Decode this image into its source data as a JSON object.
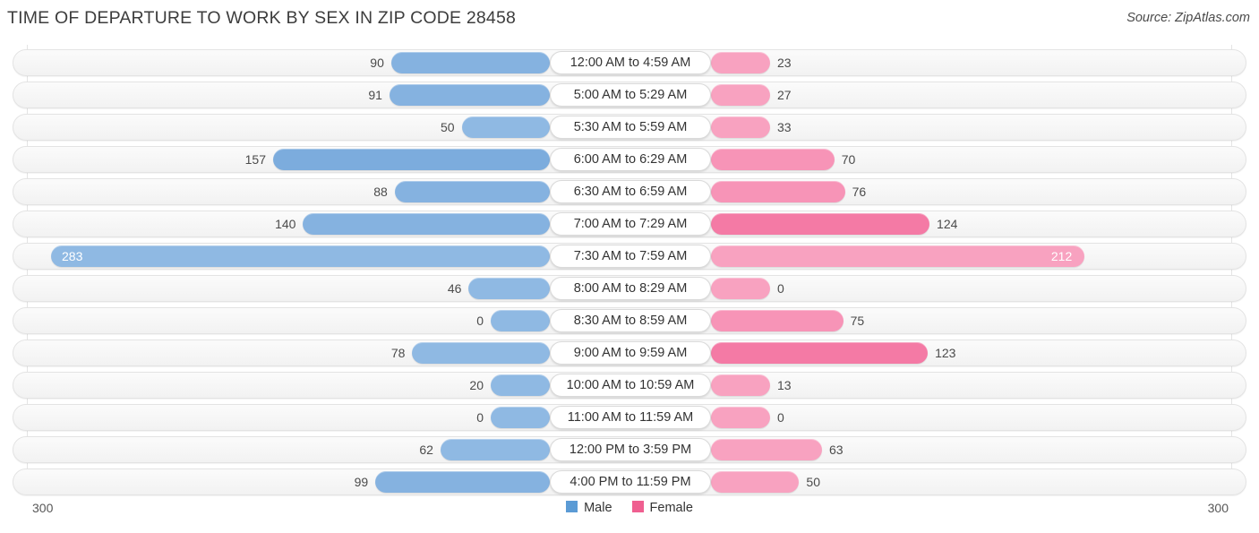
{
  "header": {
    "title": "TIME OF DEPARTURE TO WORK BY SEX IN ZIP CODE 28458",
    "source": "Source: ZipAtlas.com"
  },
  "legend": {
    "male_label": "Male",
    "female_label": "Female",
    "male_color": "#5b9bd5",
    "female_color": "#ef5f90"
  },
  "axis": {
    "left_end": "300",
    "right_end": "300"
  },
  "chart_data": {
    "type": "bar",
    "orientation": "horizontal-diverging",
    "title": "TIME OF DEPARTURE TO WORK BY SEX IN ZIP CODE 28458",
    "xlabel": "",
    "ylabel": "",
    "xlim": [
      -300,
      300
    ],
    "axis_max": 300,
    "grid": true,
    "legend_position": "bottom-center",
    "categories": [
      "12:00 AM to 4:59 AM",
      "5:00 AM to 5:29 AM",
      "5:30 AM to 5:59 AM",
      "6:00 AM to 6:29 AM",
      "6:30 AM to 6:59 AM",
      "7:00 AM to 7:29 AM",
      "7:30 AM to 7:59 AM",
      "8:00 AM to 8:29 AM",
      "8:30 AM to 8:59 AM",
      "9:00 AM to 9:59 AM",
      "10:00 AM to 10:59 AM",
      "11:00 AM to 11:59 AM",
      "12:00 PM to 3:59 PM",
      "4:00 PM to 11:59 PM"
    ],
    "series": [
      {
        "name": "Male",
        "color": "#5b9bd5",
        "values": [
          90,
          91,
          50,
          157,
          88,
          140,
          283,
          46,
          0,
          78,
          20,
          0,
          62,
          99
        ]
      },
      {
        "name": "Female",
        "color": "#ef5f90",
        "values": [
          23,
          27,
          33,
          70,
          76,
          124,
          212,
          0,
          75,
          123,
          13,
          0,
          63,
          50
        ]
      }
    ]
  }
}
